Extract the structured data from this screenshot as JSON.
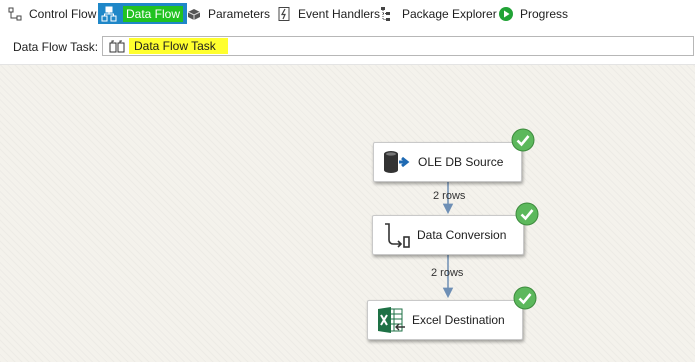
{
  "tabs": [
    {
      "label": "Control Flow",
      "icon": "control-flow-icon"
    },
    {
      "label": "Data Flow",
      "icon": "data-flow-icon",
      "active": true
    },
    {
      "label": "Parameters",
      "icon": "parameters-icon"
    },
    {
      "label": "Event Handlers",
      "icon": "event-handlers-icon"
    },
    {
      "label": "Package Explorer",
      "icon": "package-explorer-icon"
    },
    {
      "label": "Progress",
      "icon": "progress-icon"
    }
  ],
  "taskbar": {
    "label": "Data Flow Task:",
    "selected": "Data Flow Task"
  },
  "canvas": {
    "nodes": [
      {
        "label": "OLE DB Source",
        "icon": "ole-db-source-icon",
        "status": "success"
      },
      {
        "label": "Data Conversion",
        "icon": "data-conversion-icon",
        "status": "success"
      },
      {
        "label": "Excel Destination",
        "icon": "excel-destination-icon",
        "status": "success"
      }
    ],
    "paths": [
      {
        "label": "2 rows"
      },
      {
        "label": "2 rows"
      }
    ]
  },
  "colors": {
    "active_tab_bg": "#1f87c8",
    "active_tab_label_bg": "#21c221",
    "task_highlight": "#ffff2e",
    "success": "#5cb85c",
    "connector": "#6e8fb5"
  }
}
